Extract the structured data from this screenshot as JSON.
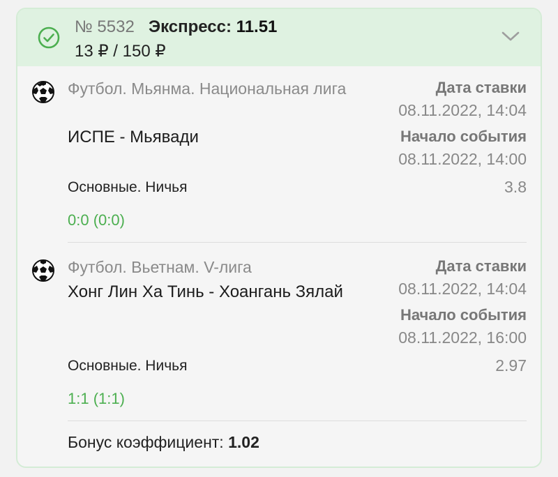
{
  "header": {
    "bet_number": "№ 5532",
    "bet_type_label": "Экспресс:",
    "total_odds": "11.51",
    "amount": "13 ₽ / 150 ₽",
    "status_icon": "check-circle-icon",
    "expand_icon": "chevron-down-icon"
  },
  "events": [
    {
      "sport_icon": "soccer-ball-icon",
      "league": "Футбол. Мьянма. Национальная лига",
      "match": "ИСПЕ - Мьявади",
      "market": "Основные. Ничья",
      "score": "0:0 (0:0)",
      "bet_date_label": "Дата ставки",
      "bet_date": "08.11.2022, 14:04",
      "event_start_label": "Начало события",
      "event_start": "08.11.2022, 14:00",
      "odds": "3.8"
    },
    {
      "sport_icon": "soccer-ball-icon",
      "league": "Футбол. Вьетнам. V-лига",
      "match": "Хонг Лин Ха Тинь - Хоангань Зялай",
      "market": "Основные. Ничья",
      "score": "1:1 (1:1)",
      "bet_date_label": "Дата ставки",
      "bet_date": "08.11.2022, 14:04",
      "event_start_label": "Начало события",
      "event_start": "08.11.2022, 16:00",
      "odds": "2.97"
    }
  ],
  "bonus": {
    "label": "Бонус коэффициент:",
    "value": "1.02"
  },
  "colors": {
    "header_bg": "#dff2e1",
    "accent_green": "#4caf50",
    "border": "#d4ecd6"
  }
}
